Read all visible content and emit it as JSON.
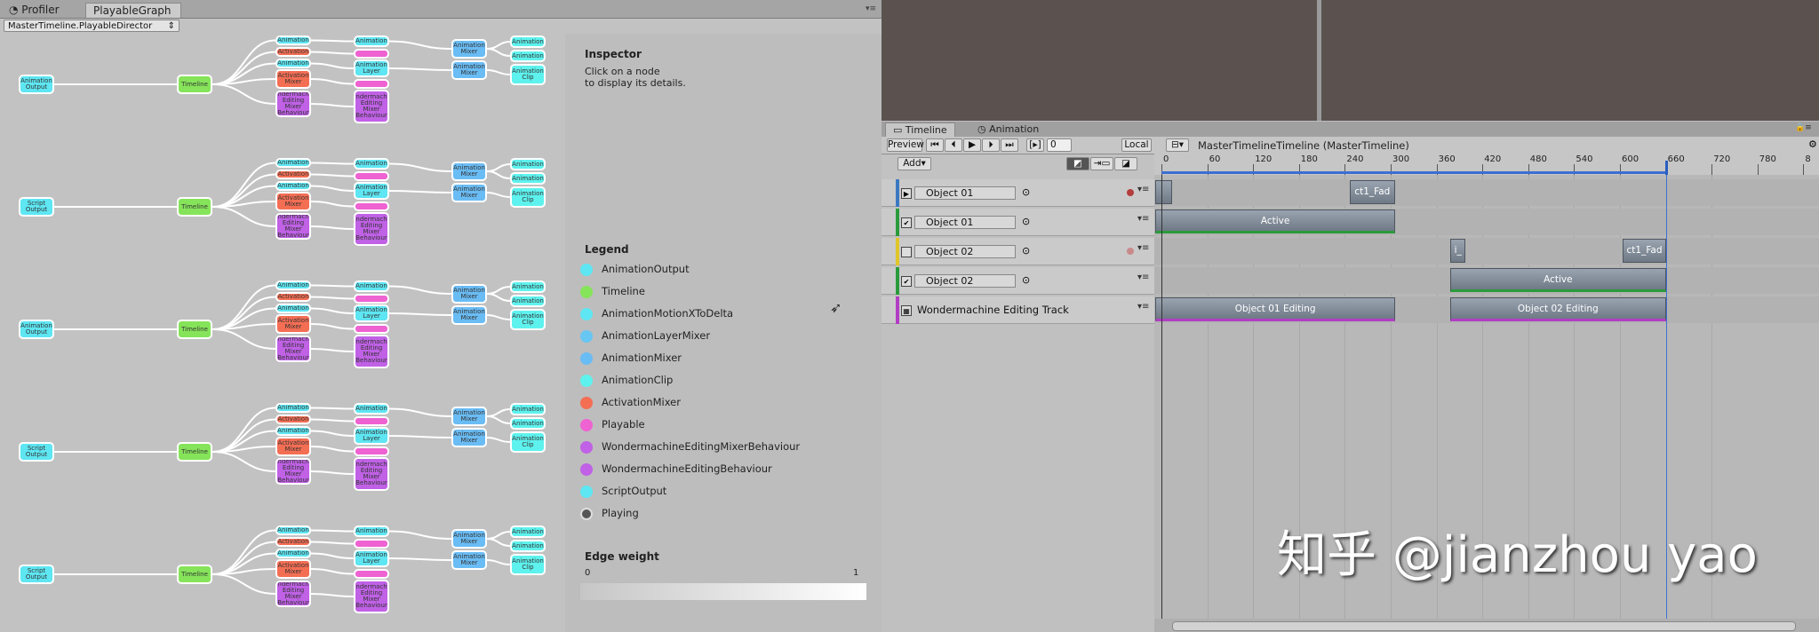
{
  "left_panel": {
    "tabs": [
      "Profiler",
      "PlayableGraph"
    ],
    "selected_tab": "PlayableGraph",
    "director_select": "MasterTimeline.PlayableDirector",
    "graph": {
      "output_labels": [
        "Animation\nOutput",
        "Script\nOutput",
        "Animation\nOutput",
        "Script\nOutput",
        "Script\nOutput"
      ],
      "timeline_label": "Timeline",
      "activation_label": "Activation",
      "activation_mixer_label": "Activation\nMixer",
      "animation_label": "Animation",
      "animation_layer_label": "Animation\nLayer",
      "animation_mixer_label": "Animation\nMixer",
      "animation_clip_label": "Animation\nClip",
      "wm_label": "Wondermachine\nEditing\nMixer\nBehaviour"
    },
    "inspector": {
      "title": "Inspector",
      "hint": "Click on a node\nto display its details."
    },
    "legend": {
      "title": "Legend",
      "items": [
        {
          "label": "AnimationOutput",
          "color": "#5ee6f2"
        },
        {
          "label": "Timeline",
          "color": "#86e45a"
        },
        {
          "label": "AnimationMotionXToDelta",
          "color": "#5ee6f2"
        },
        {
          "label": "AnimationLayerMixer",
          "color": "#68c6f2"
        },
        {
          "label": "AnimationMixer",
          "color": "#6abcf4"
        },
        {
          "label": "AnimationClip",
          "color": "#5ef2ee"
        },
        {
          "label": "ActivationMixer",
          "color": "#f46e54"
        },
        {
          "label": "Playable",
          "color": "#ee62d2"
        },
        {
          "label": "WondermachineEditingMixerBehaviour",
          "color": "#c061e6"
        },
        {
          "label": "WondermachineEditingBehaviour",
          "color": "#c061e6"
        },
        {
          "label": "ScriptOutput",
          "color": "#5ee6f2"
        },
        {
          "label": "Playing",
          "color": "#888888"
        }
      ]
    },
    "edge_weight": {
      "title": "Edge weight",
      "min": "0",
      "max": "1"
    }
  },
  "timeline": {
    "tabs": [
      "Timeline",
      "Animation"
    ],
    "preview_label": "Preview",
    "frame_value": "0",
    "local_label": "Local",
    "add_label": "Add",
    "timeline_title": "MasterTimelineTimeline (MasterTimeline)",
    "ruler": [
      "0",
      "60",
      "120",
      "180",
      "240",
      "300",
      "360",
      "420",
      "480",
      "540",
      "600",
      "660",
      "720",
      "780",
      "8"
    ],
    "playhead_frame": 660,
    "tracks": [
      {
        "name": "Object 01",
        "color": "#3b78c2"
      },
      {
        "name": "Object 01",
        "color": "#2a9b3b"
      },
      {
        "name": "Object 02",
        "color": "#e0c52a"
      },
      {
        "name": "Object 02",
        "color": "#2a9b3b"
      },
      {
        "name": "Wondermachine Editing Track",
        "color": "#b23dc4"
      }
    ],
    "clips": {
      "t1_fade": "ct1_Fad",
      "t1_active": "Active",
      "t2_short": "i_",
      "t2_fade": "ct1_Fad",
      "t3_active": "Active",
      "edit1": "Object 01 Editing",
      "edit2": "Object 02 Editing"
    },
    "watermark": "知乎 @jianzhou yao"
  }
}
